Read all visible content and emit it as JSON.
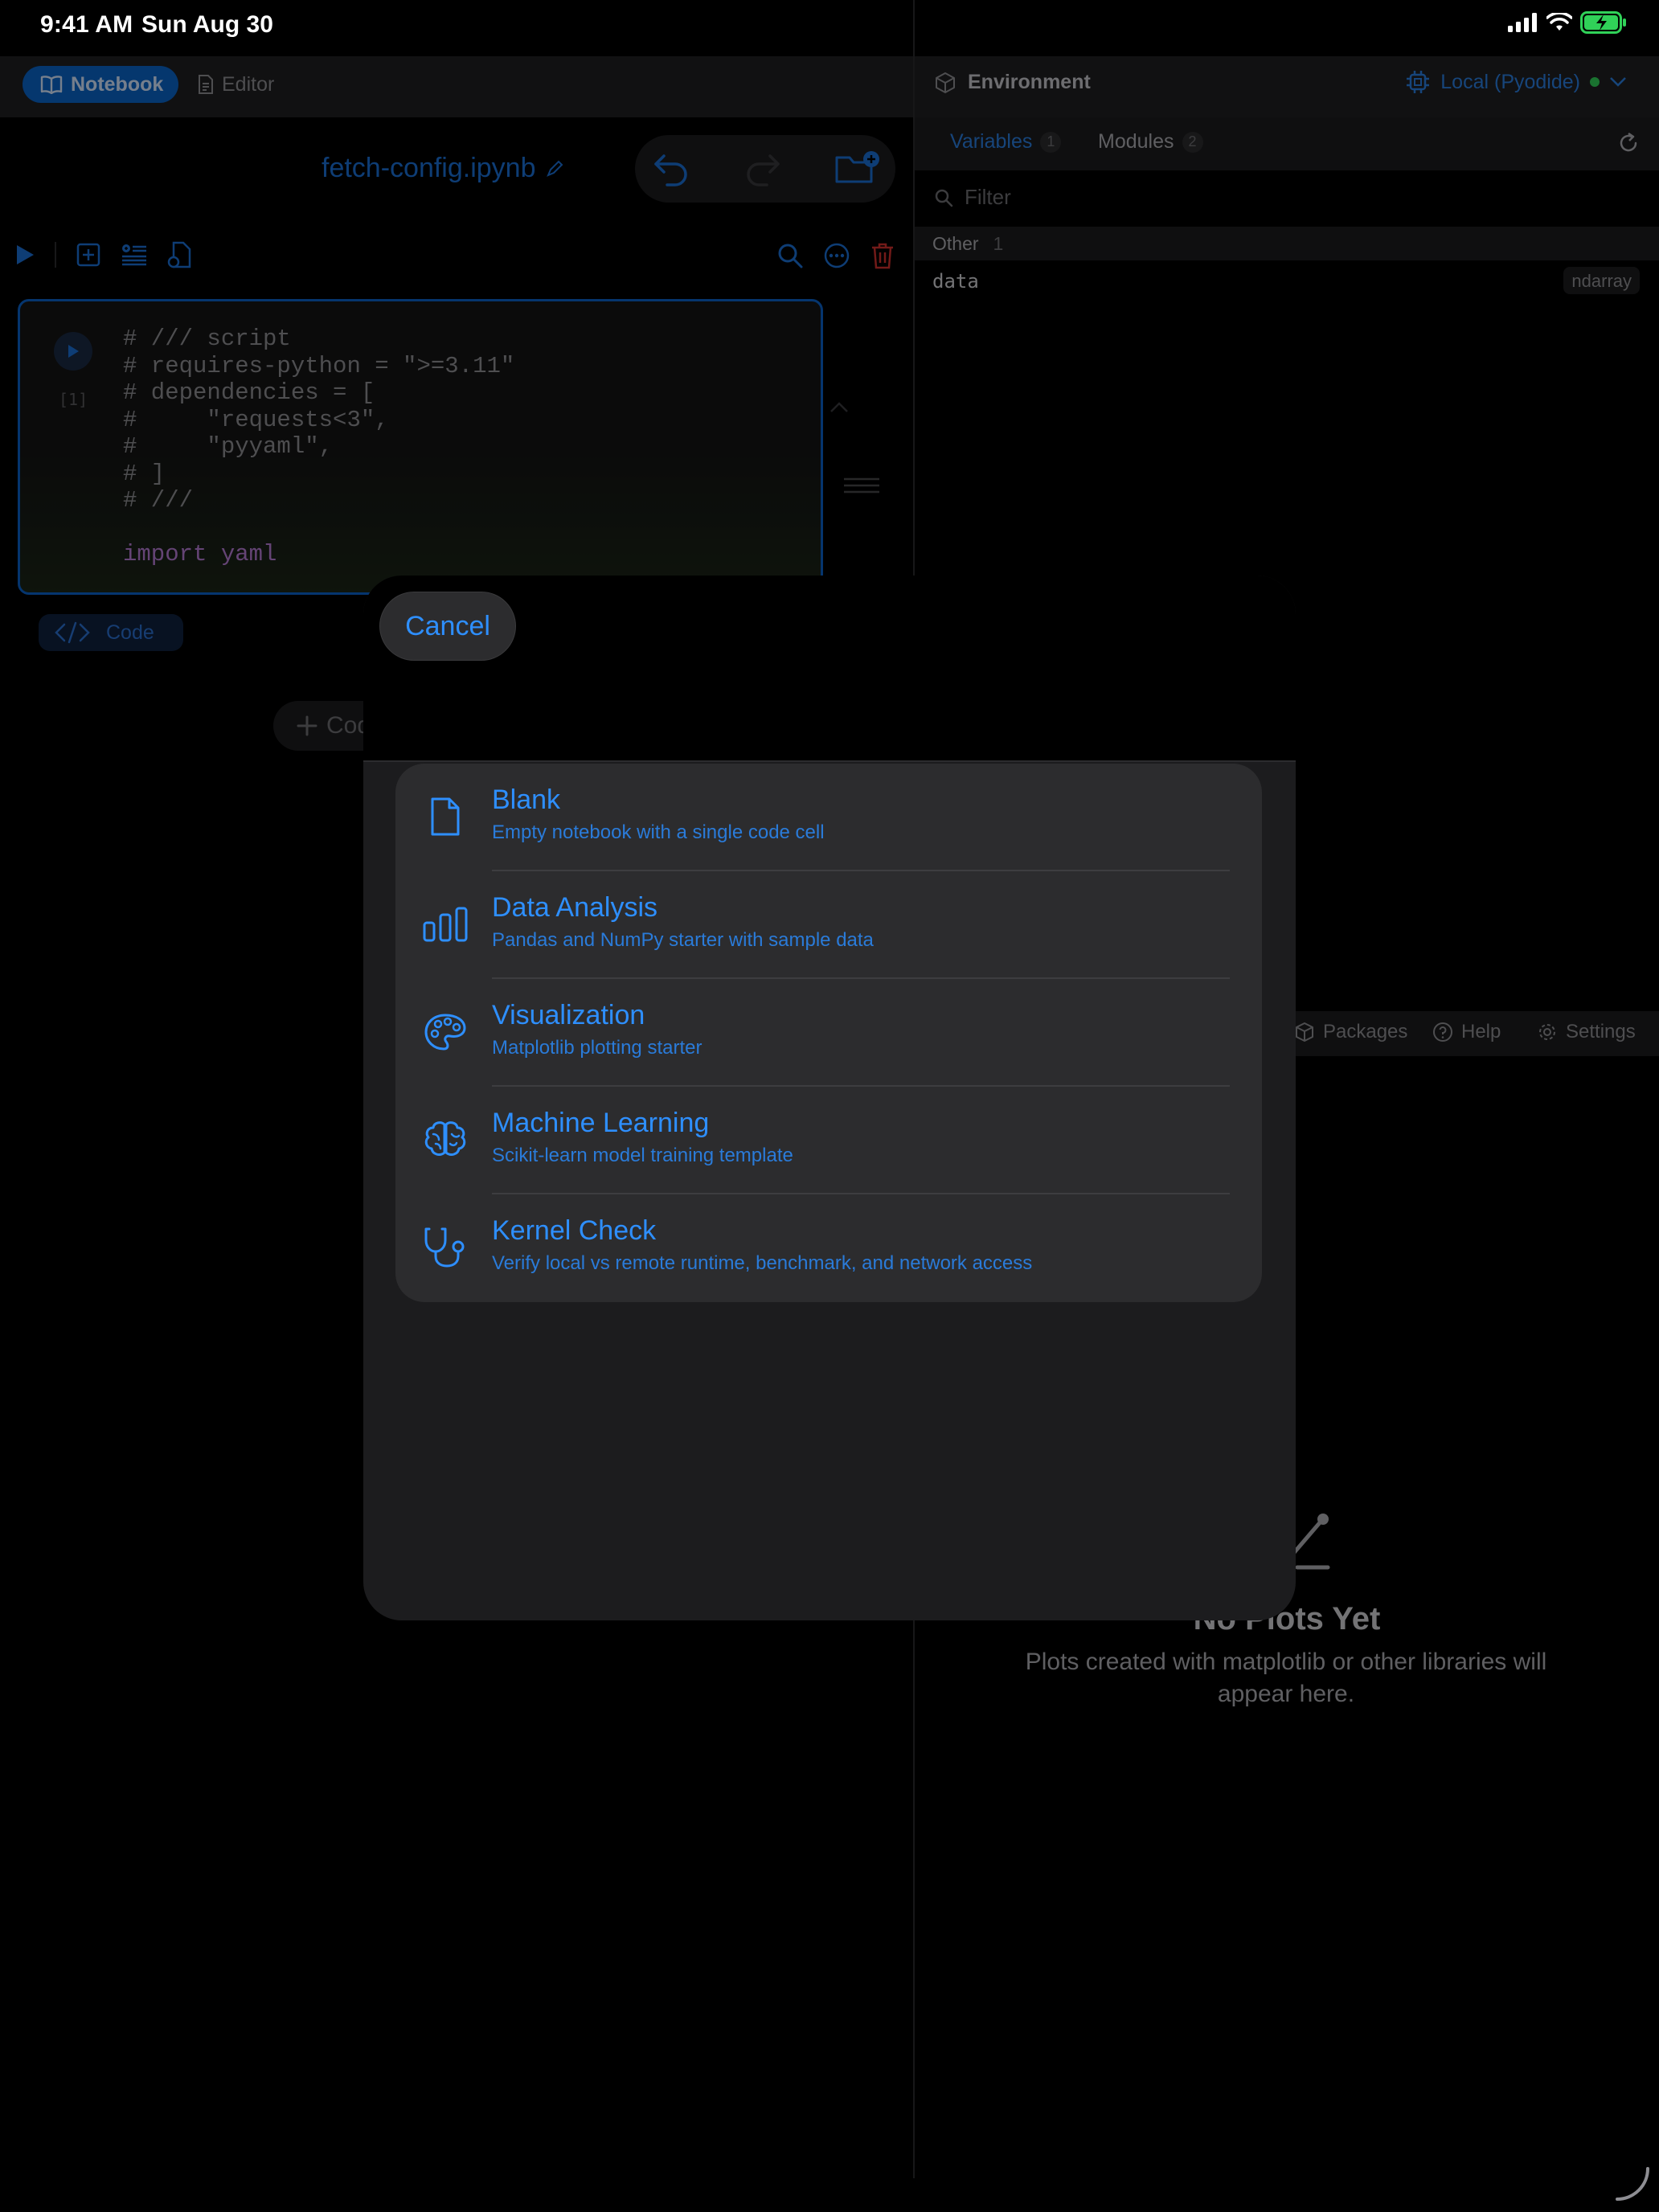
{
  "status_bar": {
    "time": "9:41 AM",
    "date": "Sun Aug 30"
  },
  "top_segment": {
    "notebook_label": "Notebook",
    "editor_label": "Editor"
  },
  "notebook": {
    "filename": "fetch-config.ipynb"
  },
  "cell": {
    "execution_count": "[1]",
    "code_lines": [
      "# /// script",
      "# requires-python = \">=3.11\"",
      "# dependencies = [",
      "#     \"requests<3\",",
      "#     \"pyyaml\",",
      "# ]",
      "# ///",
      "",
      "import yaml"
    ],
    "type_label": "Code"
  },
  "add_cell_label": "Cod",
  "environment": {
    "title": "Environment",
    "runtime_label": "Local (Pyodide)",
    "runtime_status_color": "#30d158",
    "tabs": [
      {
        "label": "Variables",
        "count": "1"
      },
      {
        "label": "Modules",
        "count": "2"
      }
    ],
    "filter_placeholder": "Filter",
    "groups": [
      {
        "label": "Other",
        "count": "1",
        "variables": [
          {
            "name": "data",
            "type": "ndarray"
          }
        ]
      }
    ]
  },
  "bottom_tabs": [
    {
      "label": "Packages"
    },
    {
      "label": "Help"
    },
    {
      "label": "Settings"
    }
  ],
  "plots": {
    "empty_title": "No Plots Yet",
    "empty_description": "Plots created with matplotlib or other libraries will appear here."
  },
  "sheet": {
    "cancel_label": "Cancel",
    "templates": [
      {
        "icon": "document-icon",
        "title": "Blank",
        "subtitle": "Empty notebook with a single code cell"
      },
      {
        "icon": "bar-chart-icon",
        "title": "Data Analysis",
        "subtitle": "Pandas and NumPy starter with sample data"
      },
      {
        "icon": "palette-icon",
        "title": "Visualization",
        "subtitle": "Matplotlib plotting starter"
      },
      {
        "icon": "brain-icon",
        "title": "Machine Learning",
        "subtitle": "Scikit-learn model training template"
      },
      {
        "icon": "stethoscope-icon",
        "title": "Kernel Check",
        "subtitle": "Verify local vs remote runtime, benchmark, and network access"
      }
    ]
  },
  "colors": {
    "accent": "#2e8fff",
    "sheet_bg": "#1c1c1e",
    "card_bg": "#2c2c2e",
    "danger": "#ff453a"
  }
}
